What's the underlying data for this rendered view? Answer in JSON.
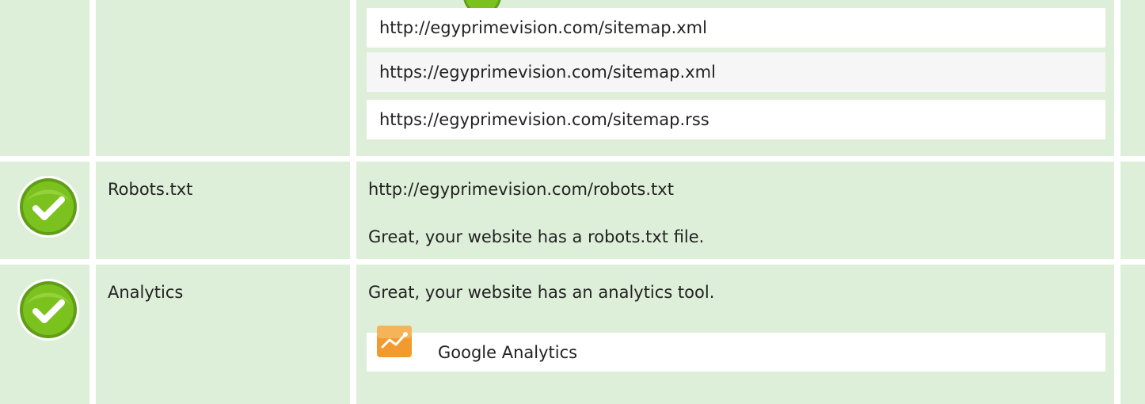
{
  "sitemaps": {
    "items": [
      "http://egyprimevision.com/sitemap.xml",
      "https://egyprimevision.com/sitemap.xml",
      "https://egyprimevision.com/sitemap.rss"
    ]
  },
  "robots": {
    "status_icon": "check-icon",
    "label": "Robots.txt",
    "url": "http://egyprimevision.com/robots.txt",
    "message": "Great, your website has a robots.txt file."
  },
  "analytics": {
    "status_icon": "check-icon",
    "label": "Analytics",
    "message": "Great, your website has an analytics tool.",
    "tool_name": "Google Analytics",
    "tool_icon": "google-analytics-icon"
  },
  "colors": {
    "row_background": "#deefd9",
    "check_green": "#7cc21f",
    "analytics_orange": "#f29a2e"
  }
}
